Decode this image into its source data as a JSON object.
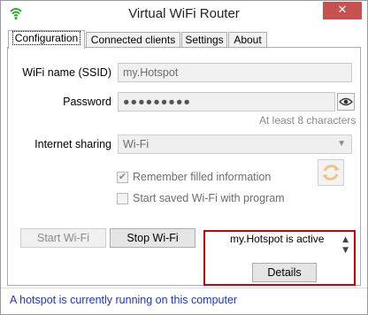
{
  "window": {
    "title": "Virtual WiFi Router",
    "close_glyph": "✕",
    "app_icon": "wifi-signal-icon"
  },
  "tabs": [
    {
      "label": "Configuration",
      "active": true
    },
    {
      "label": "Connected clients",
      "active": false
    },
    {
      "label": "Settings",
      "active": false
    },
    {
      "label": "About",
      "active": false
    }
  ],
  "config": {
    "ssid_label": "WiFi name (SSID)",
    "ssid_value": "my.Hotspot",
    "password_label": "Password",
    "password_value": "●●●●●●●●●",
    "password_hint": "At least 8 characters",
    "sharing_label": "Internet sharing",
    "sharing_value": "Wi-Fi",
    "remember_label": "Remember filled information",
    "remember_checked": true,
    "remember_glyph": "✔",
    "autostart_label": "Start saved Wi-Fi with program",
    "autostart_checked": false
  },
  "actions": {
    "start_label": "Start Wi-Fi",
    "stop_label": "Stop Wi-Fi"
  },
  "status_panel": {
    "text": "my.Hotspot is active",
    "details_label": "Details",
    "scroll_up_glyph": "▲",
    "scroll_down_glyph": "▼"
  },
  "statusbar": {
    "text": "A hotspot is currently running on this computer",
    "color": "#1a36c8"
  },
  "colors": {
    "highlight_border": "#d10000",
    "close_button": "#c75050"
  }
}
